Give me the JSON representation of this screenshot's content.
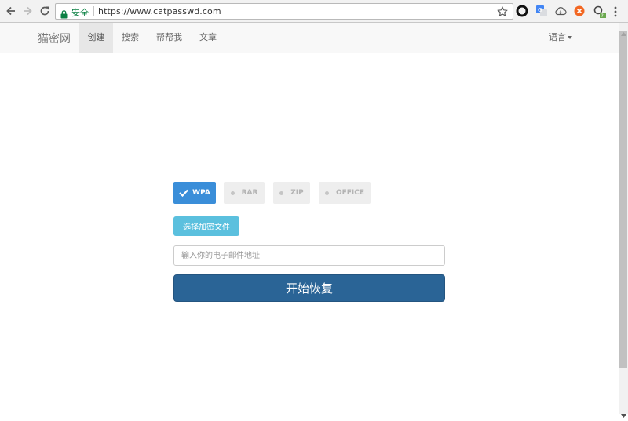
{
  "browser": {
    "security_label": "安全",
    "url": "https://www.catpasswd.com",
    "icons": [
      "back-icon",
      "forward-icon",
      "reload-icon",
      "lock-icon",
      "star-icon",
      "circle-extension-icon",
      "translate-extension-icon",
      "cloud-extension-icon",
      "adblock-extension-icon",
      "search-extension-icon",
      "menu-icon"
    ]
  },
  "navbar": {
    "brand": "猫密网",
    "items": [
      {
        "label": "创建",
        "active": true
      },
      {
        "label": "搜索",
        "active": false
      },
      {
        "label": "帮帮我",
        "active": false
      },
      {
        "label": "文章",
        "active": false
      }
    ],
    "language": "语言"
  },
  "main": {
    "types": [
      {
        "label": "WPA",
        "selected": true
      },
      {
        "label": "RAR",
        "selected": false
      },
      {
        "label": "ZIP",
        "selected": false
      },
      {
        "label": "OFFICE",
        "selected": false
      }
    ],
    "file_button": "选择加密文件",
    "email_placeholder": "输入你的电子邮件地址",
    "start_button": "开始恢复"
  },
  "colors": {
    "primary": "#2a6496",
    "selected": "#3a8ed9",
    "info": "#5bc0de",
    "secure_green": "#0b8043"
  }
}
